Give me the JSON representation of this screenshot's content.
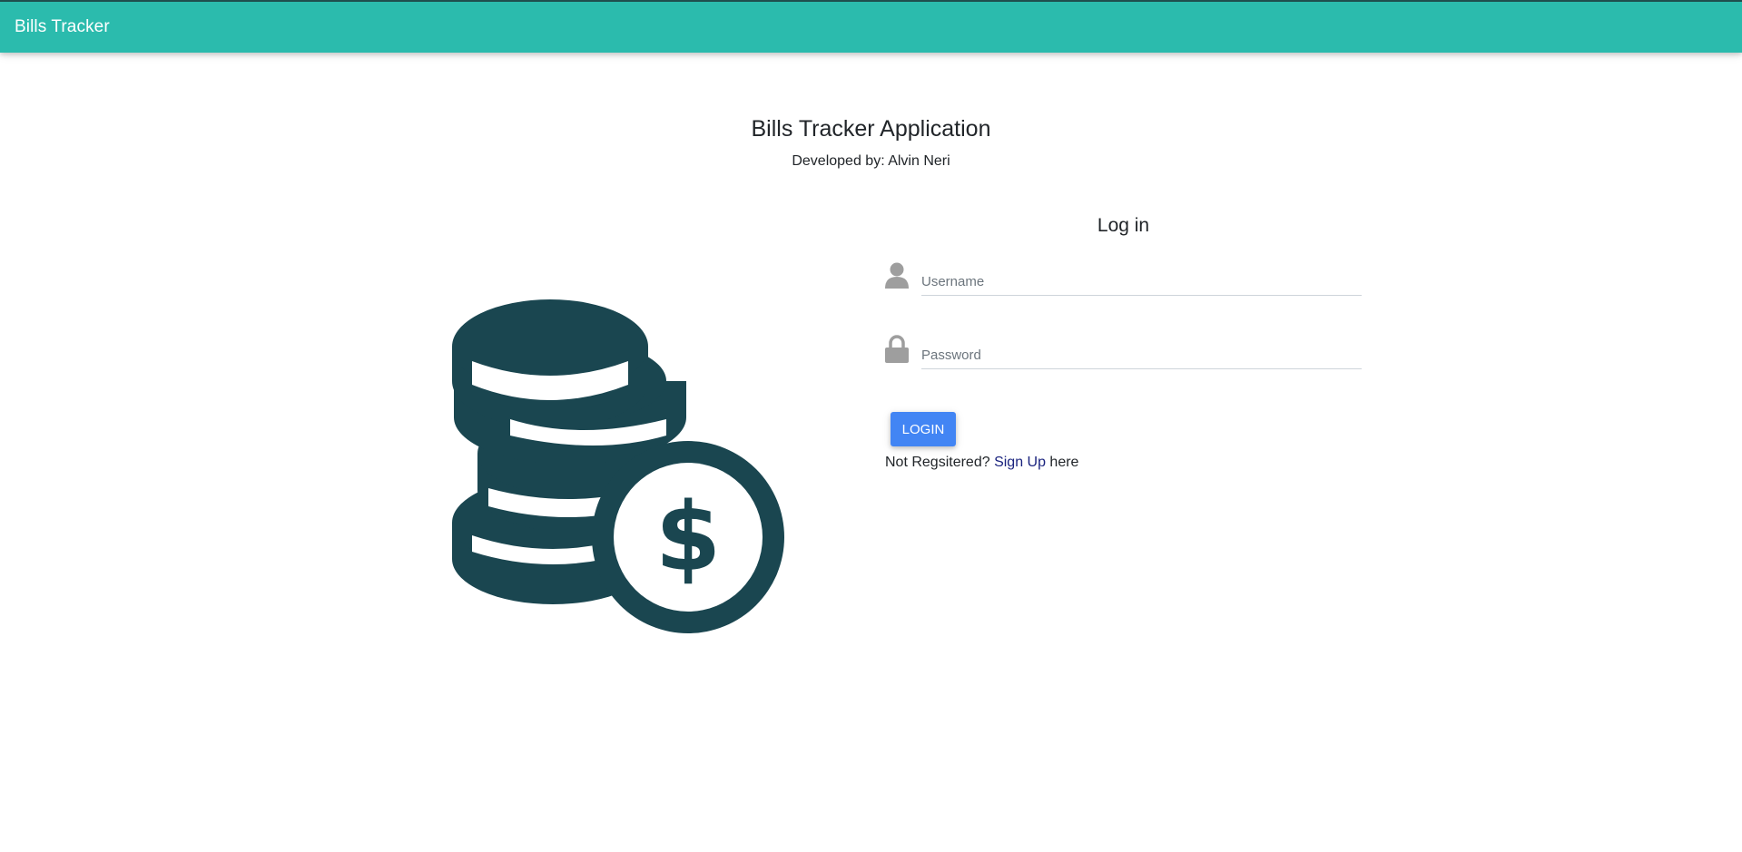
{
  "navbar": {
    "brand": "Bills Tracker"
  },
  "header": {
    "title": "Bills Tracker Application",
    "subtitle": "Developed by: Alvin Neri"
  },
  "illustration": {
    "icon": "coins-dollar-icon",
    "color": "#1a4650"
  },
  "login": {
    "title": "Log in",
    "username": {
      "value": "",
      "placeholder": "Username",
      "icon": "user-icon"
    },
    "password": {
      "value": "",
      "placeholder": "Password",
      "icon": "lock-icon"
    },
    "button_label": "LOGIN",
    "signup_prefix": "Not Regsitered? ",
    "signup_link": "Sign Up",
    "signup_suffix": " here"
  },
  "colors": {
    "navbar": "#2bbbad",
    "button": "#4285f4",
    "link": "#1a237e",
    "icon_gray": "#9e9e9e"
  }
}
